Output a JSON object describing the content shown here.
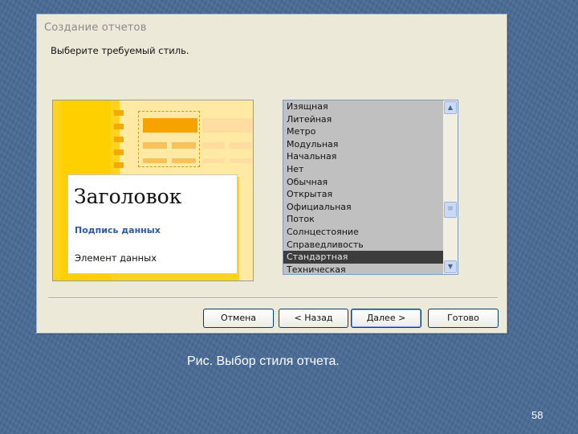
{
  "dialog": {
    "title": "Создание отчетов",
    "instruction": "Выберите требуемый стиль."
  },
  "preview": {
    "heading": "Заголовок",
    "caption": "Подпись данных",
    "field": "Элемент данных"
  },
  "style_list": {
    "items": [
      {
        "label": "Изящная"
      },
      {
        "label": "Литейная"
      },
      {
        "label": "Метро"
      },
      {
        "label": "Модульная"
      },
      {
        "label": "Начальная"
      },
      {
        "label": "Нет"
      },
      {
        "label": "Обычная"
      },
      {
        "label": "Открытая"
      },
      {
        "label": "Официальная"
      },
      {
        "label": "Поток"
      },
      {
        "label": "Солнцестояние"
      },
      {
        "label": "Справедливость"
      },
      {
        "label": "Стандартная"
      },
      {
        "label": "Техническая"
      }
    ],
    "selected": "Стандартная"
  },
  "buttons": {
    "cancel": "Отмена",
    "back": "< Назад",
    "next": "Далее >",
    "finish": "Готово"
  },
  "slide": {
    "caption": "Рис. Выбор стиля отчета.",
    "page_number": "58"
  },
  "colors": {
    "slide_background": "#4a6c97",
    "dialog_background": "#ece9d8",
    "preview_yellow": "#ffd21e",
    "selected_item": "#3d3d3d"
  }
}
